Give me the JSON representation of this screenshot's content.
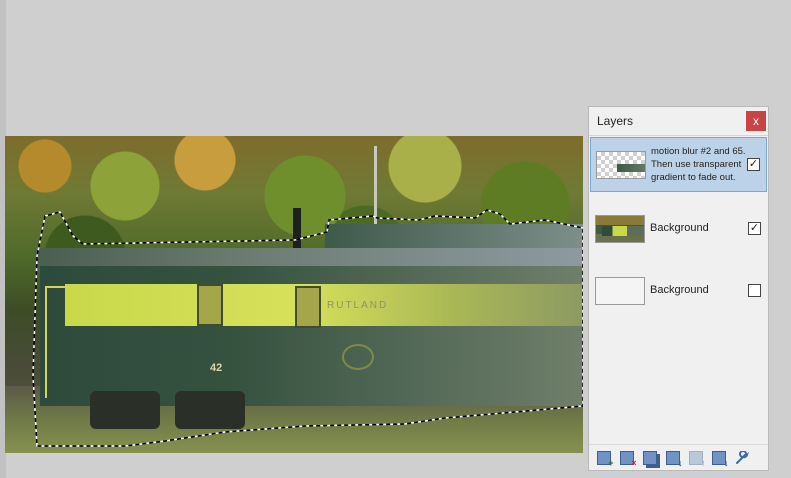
{
  "canvas": {
    "car_number": "42",
    "car_lettering": "RUTLAND"
  },
  "layers_panel": {
    "title": "Layers",
    "close_label": "x",
    "layers": [
      {
        "name": "motion blur #2  and 65.  Then use transparent gradient to fade out.",
        "visible": true,
        "selected": true,
        "thumb": "checker-train"
      },
      {
        "name": "Background",
        "visible": true,
        "selected": false,
        "thumb": "photo"
      },
      {
        "name": "Background",
        "visible": false,
        "selected": false,
        "thumb": "blank"
      }
    ],
    "check_mark": "✓",
    "toolbar": [
      {
        "icon": "add-layer-icon",
        "mark": "+"
      },
      {
        "icon": "delete-layer-icon",
        "mark": "×"
      },
      {
        "icon": "duplicate-layer-icon",
        "mark": ""
      },
      {
        "icon": "merge-layer-down-icon",
        "mark": "↓"
      },
      {
        "icon": "move-layer-up-icon",
        "mark": "↑"
      },
      {
        "icon": "move-layer-down-icon",
        "mark": "↓"
      },
      {
        "icon": "layer-properties-icon",
        "mark": "🔧"
      }
    ]
  }
}
